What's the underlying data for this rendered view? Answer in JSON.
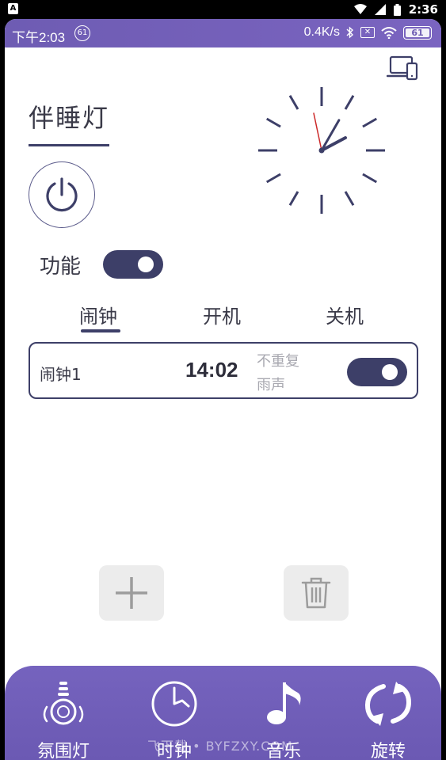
{
  "system_bar": {
    "badge": "A",
    "time": "2:36"
  },
  "app_status_bar": {
    "time": "下午2:03",
    "notification_count": "61",
    "net_speed": "0.4K/s",
    "battery": "61"
  },
  "header": {
    "title": "伴睡灯"
  },
  "clock": {
    "hour": 2,
    "minute": 4,
    "second": 58,
    "hand_color": "#3d3f68",
    "second_hand_color": "#cc2a2a"
  },
  "function": {
    "label": "功能",
    "enabled": true
  },
  "tabs": [
    {
      "label": "闹钟",
      "active": true
    },
    {
      "label": "开机",
      "active": false
    },
    {
      "label": "关机",
      "active": false
    }
  ],
  "alarms": [
    {
      "name": "闹钟1",
      "time": "14:02",
      "repeat": "不重复",
      "sound": "雨声",
      "enabled": true
    }
  ],
  "actions": {
    "add_icon": "plus-icon",
    "delete_icon": "trash-icon"
  },
  "bottom_nav": [
    {
      "label": "氛围灯",
      "icon": "ambient-light-icon"
    },
    {
      "label": "时钟",
      "icon": "clock-icon"
    },
    {
      "label": "音乐",
      "icon": "music-note-icon"
    },
    {
      "label": "旋转",
      "icon": "rotate-icon"
    }
  ],
  "watermark": "飞下载 • BYFZXY.COM",
  "colors": {
    "accent": "#3d3f68",
    "purple": "#7563be",
    "muted_text": "#a8a8b0"
  }
}
